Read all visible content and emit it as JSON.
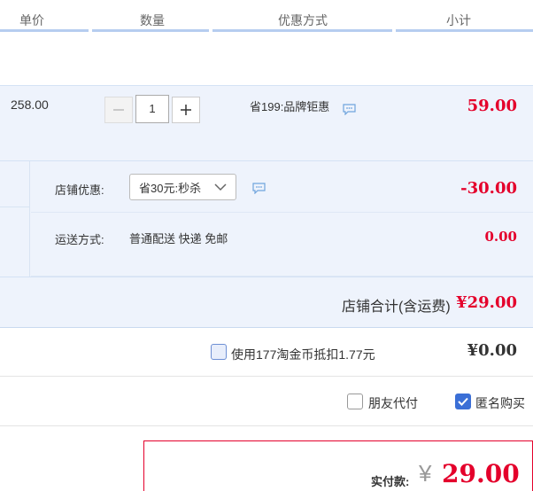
{
  "header": {
    "col_price": "单价",
    "col_qty": "数量",
    "col_promo": "优惠方式",
    "col_subtotal": "小计"
  },
  "item": {
    "price": "258.00",
    "quantity": "1",
    "promo": "省199:品牌钜惠",
    "subtotal": "59.00"
  },
  "shop": {
    "discount_label": "店铺优惠:",
    "discount_option": "省30元:秒杀",
    "discount_value": "-30.00",
    "shipping_label": "运送方式:",
    "shipping_options": "普通配送 快递 免邮",
    "shipping_cost": "0.00",
    "total_label": "店铺合计(含运费)",
    "total_value": "¥29.00"
  },
  "coins": {
    "label": "使用177淘金币抵扣1.77元",
    "value": "¥0.00",
    "checked": false
  },
  "options": {
    "friend_pay": "朋友代付",
    "anonymous": "匿名购买"
  },
  "payment": {
    "label": "实付款:",
    "currency": "¥",
    "amount": "29.00"
  },
  "colors": {
    "accent_red": "#e4002b",
    "row_bg": "#eef3fc",
    "header_line": "#b6cdf0",
    "checkbox_blue": "#3b6fd6"
  }
}
